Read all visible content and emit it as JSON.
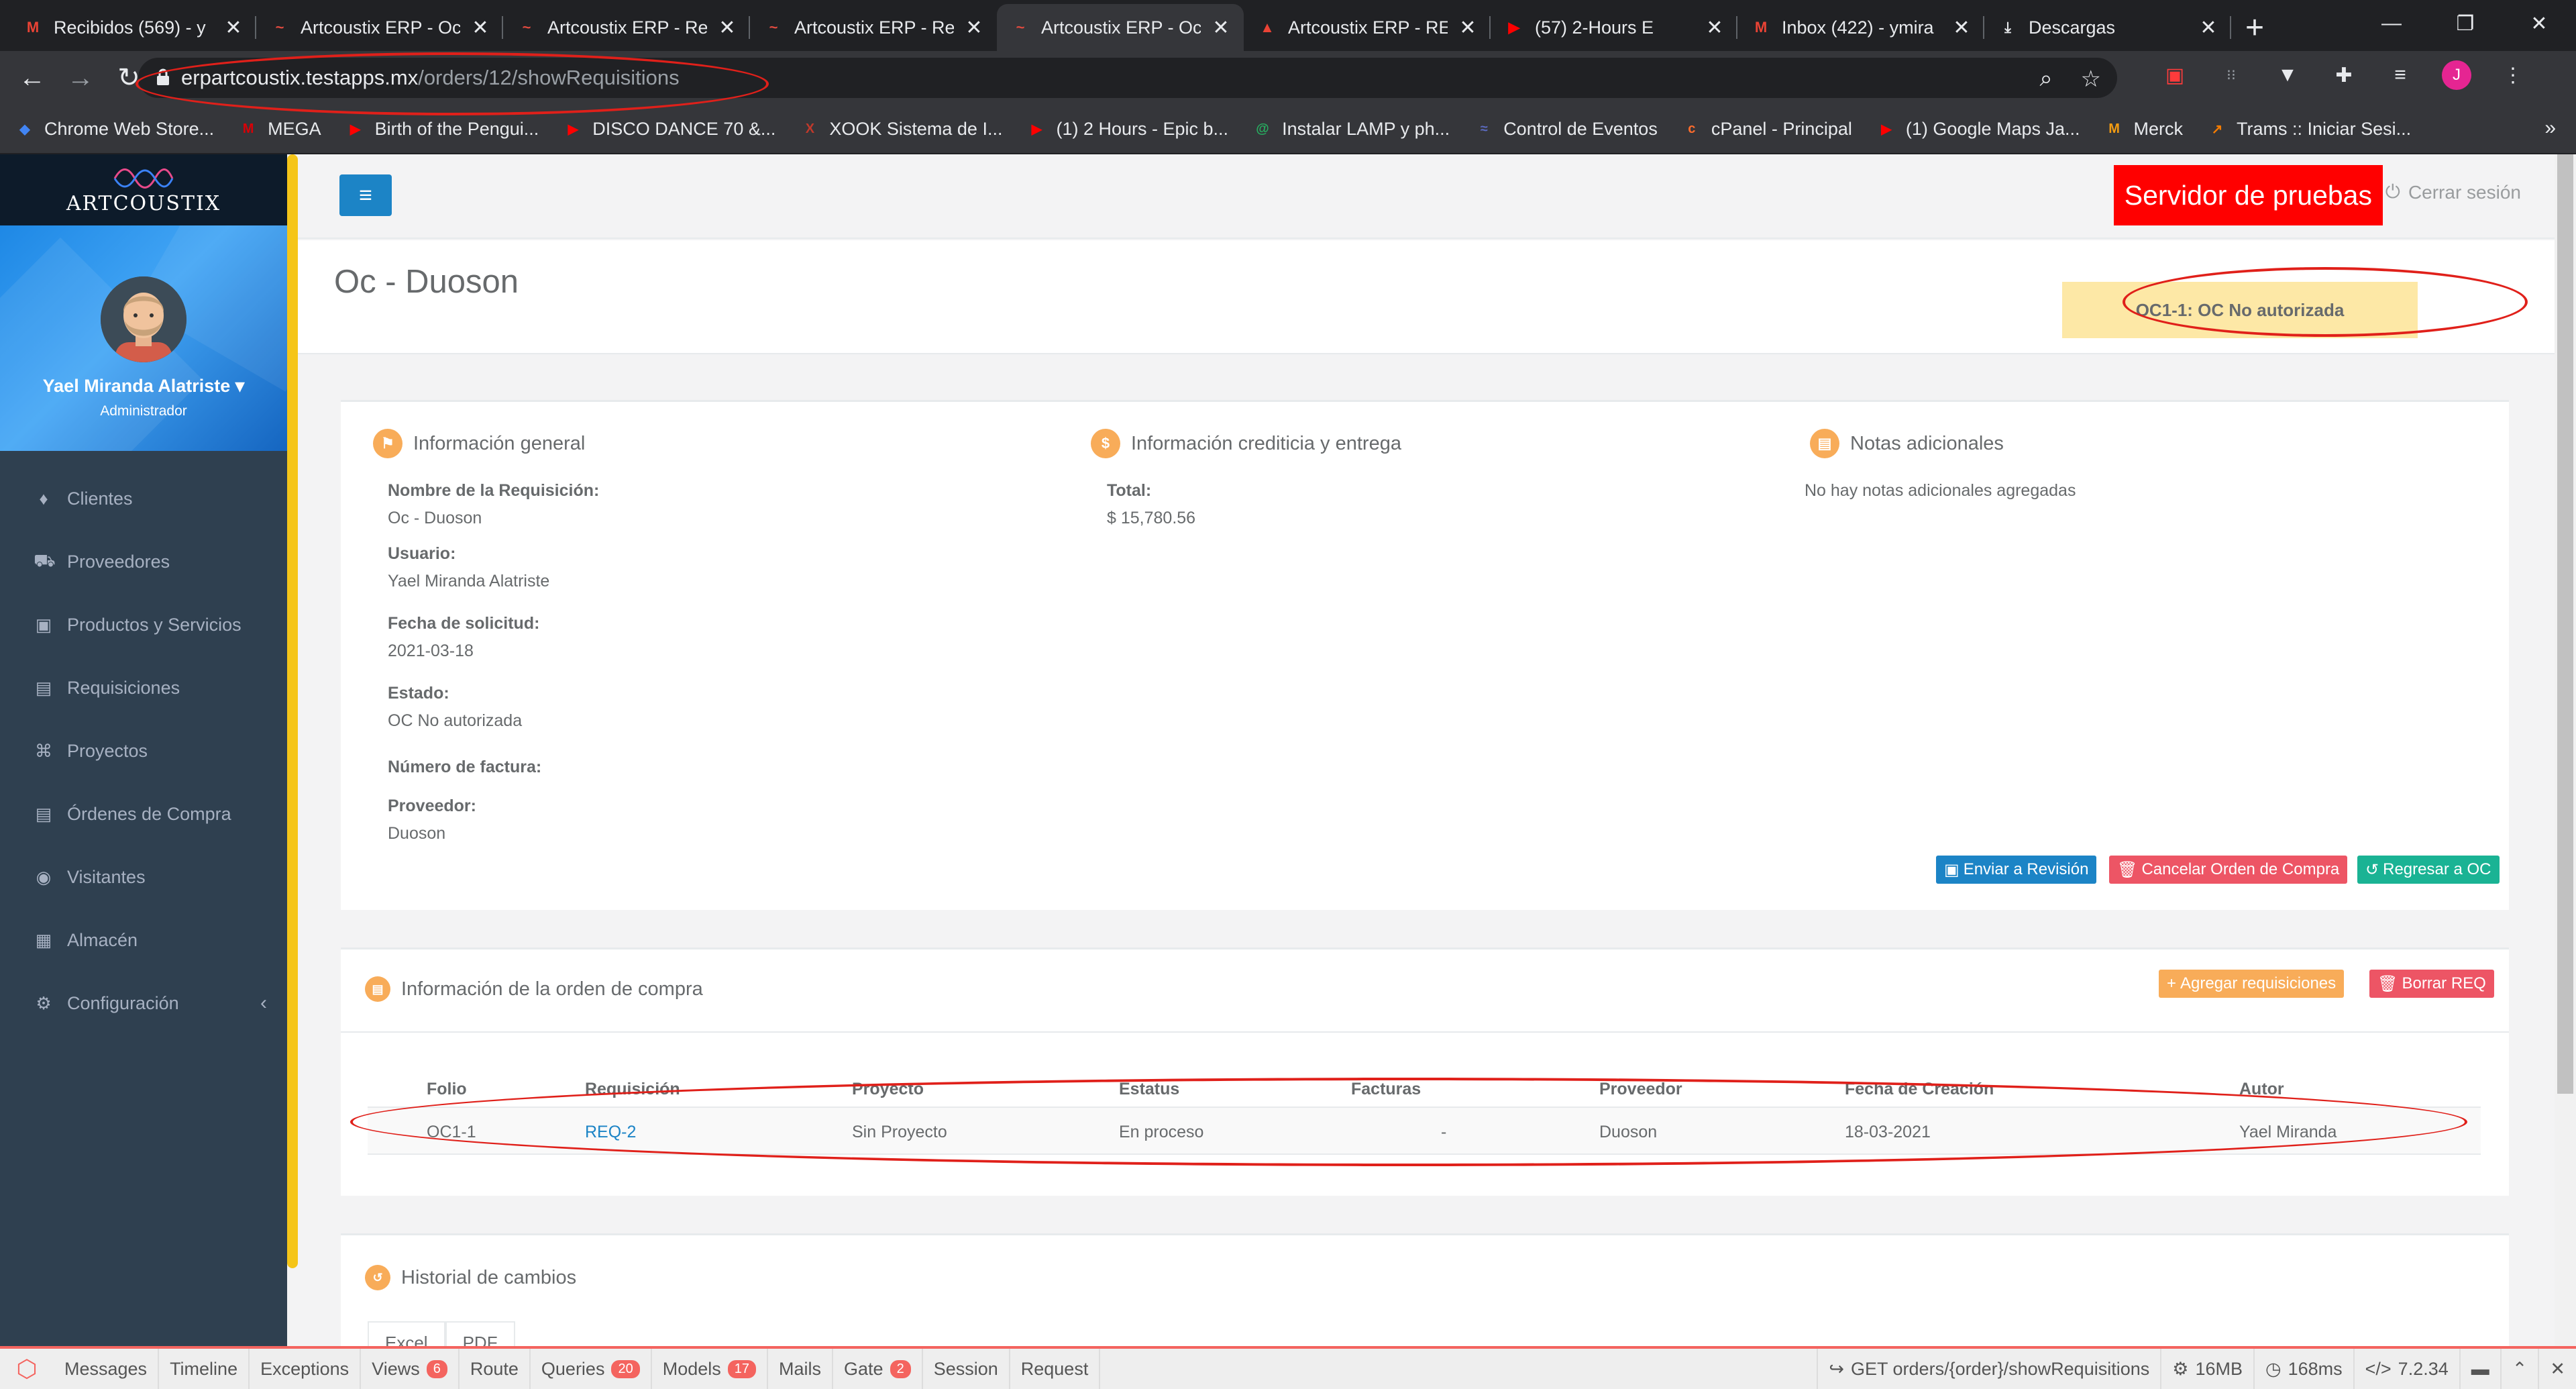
{
  "browser": {
    "tabs": [
      {
        "title": "Recibidos (569) - y",
        "favicon": "M",
        "color": "#ea4335"
      },
      {
        "title": "Artcoustix ERP - Oc",
        "favicon": "~",
        "color": "#e04a3f"
      },
      {
        "title": "Artcoustix ERP - Re",
        "favicon": "~",
        "color": "#e04a3f"
      },
      {
        "title": "Artcoustix ERP - Re",
        "favicon": "~",
        "color": "#e04a3f"
      },
      {
        "title": "Artcoustix ERP - Oc",
        "favicon": "~",
        "color": "#e04a3f"
      },
      {
        "title": "Artcoustix ERP - RE",
        "favicon": "▲",
        "color": "#ea4335"
      },
      {
        "title": "(57) 2-Hours E",
        "favicon": "▶",
        "color": "#ff0000"
      },
      {
        "title": "Inbox (422) - ymira",
        "favicon": "M",
        "color": "#ea4335"
      },
      {
        "title": "Descargas",
        "favicon": "⤓",
        "color": "#e8eaed"
      }
    ],
    "url_host": "erpartcoustix.testapps.mx",
    "url_path": "/orders/12/showRequisitions",
    "profile_letter": "J",
    "bookmarks": [
      {
        "label": "Chrome Web Store...",
        "color": "#4285f4",
        "glyph": "◆"
      },
      {
        "label": "MEGA",
        "color": "#d90007",
        "glyph": "M"
      },
      {
        "label": "Birth of the Pengui...",
        "color": "#ff0000",
        "glyph": "▶"
      },
      {
        "label": "DISCO DANCE 70 &...",
        "color": "#ff0000",
        "glyph": "▶"
      },
      {
        "label": "XOOK Sistema de I...",
        "color": "#c0392b",
        "glyph": "X"
      },
      {
        "label": "(1) 2 Hours - Epic b...",
        "color": "#ff0000",
        "glyph": "▶"
      },
      {
        "label": "Instalar LAMP y ph...",
        "color": "#27ae60",
        "glyph": "@"
      },
      {
        "label": "Control de Eventos",
        "color": "#5c6bc0",
        "glyph": "≈"
      },
      {
        "label": "cPanel - Principal",
        "color": "#ff6c2c",
        "glyph": "c"
      },
      {
        "label": "(1) Google Maps Ja...",
        "color": "#ff0000",
        "glyph": "▶"
      },
      {
        "label": "Merck",
        "color": "#f39c12",
        "glyph": "M"
      },
      {
        "label": "Trams :: Iniciar Sesi...",
        "color": "#f57c00",
        "glyph": "↗"
      }
    ]
  },
  "app": {
    "brand": "ARTCOUSTIX",
    "user_name": "Yael Miranda Alatriste",
    "user_role": "Administrador",
    "menu": [
      {
        "label": "Clientes",
        "icon": "diamond-icon",
        "glyph": "♦"
      },
      {
        "label": "Proveedores",
        "icon": "truck-icon",
        "glyph": "⛟"
      },
      {
        "label": "Productos y Servicios",
        "icon": "briefcase-icon",
        "glyph": "▣"
      },
      {
        "label": "Requisiciones",
        "icon": "file-icon",
        "glyph": "▤"
      },
      {
        "label": "Proyectos",
        "icon": "sitemap-icon",
        "glyph": "⌘"
      },
      {
        "label": "Órdenes de Compra",
        "icon": "file-icon",
        "glyph": "▤"
      },
      {
        "label": "Visitantes",
        "icon": "user-circle-icon",
        "glyph": "◉"
      },
      {
        "label": "Almacén",
        "icon": "cubes-icon",
        "glyph": "▦"
      },
      {
        "label": "Configuración",
        "icon": "cogs-icon",
        "glyph": "⚙"
      }
    ],
    "server_label": "Servidor de pruebas",
    "logout_label": "Cerrar sesión",
    "page_title": "Oc - Duoson",
    "status_label": "OC1-1: OC No autorizada"
  },
  "general": {
    "title": "Información general",
    "fields": [
      {
        "label": "Nombre de la Requisición:",
        "value": "Oc - Duoson"
      },
      {
        "label": "Usuario:",
        "value": "Yael Miranda Alatriste"
      },
      {
        "label": "Fecha de solicitud:",
        "value": "2021-03-18"
      },
      {
        "label": "Estado:",
        "value": "OC No autorizada"
      },
      {
        "label": "Número de factura:",
        "value": ""
      },
      {
        "label": "Proveedor:",
        "value": "Duoson"
      }
    ]
  },
  "credit": {
    "title": "Información crediticia y entrega",
    "total_label": "Total:",
    "total_value": "$ 15,780.56"
  },
  "notes": {
    "title": "Notas adicionales",
    "text": "No hay notas adicionales agregadas"
  },
  "actions": {
    "send_review": "Enviar a Revisión",
    "cancel_order": "Cancelar Orden de Compra",
    "back_oc": "Regresar a OC"
  },
  "order": {
    "title": "Información de la orden de compra",
    "add_req": "Agregar requisiciones",
    "delete_req": "Borrar REQ",
    "columns": [
      "Folio",
      "Requisición",
      "Proyecto",
      "Estatus",
      "Facturas",
      "Proveedor",
      "Fecha de Creación",
      "Autor"
    ],
    "rows": [
      [
        "OC1-1",
        "REQ-2",
        "Sin Proyecto",
        "En proceso",
        "-",
        "Duoson",
        "18-03-2021",
        "Yael Miranda"
      ]
    ]
  },
  "history": {
    "title": "Historial de cambios",
    "tabs": [
      "Excel",
      "PDF"
    ]
  },
  "debugbar": {
    "items": [
      {
        "label": "Messages",
        "badge": ""
      },
      {
        "label": "Timeline",
        "badge": ""
      },
      {
        "label": "Exceptions",
        "badge": ""
      },
      {
        "label": "Views",
        "badge": "6"
      },
      {
        "label": "Route",
        "badge": ""
      },
      {
        "label": "Queries",
        "badge": "20"
      },
      {
        "label": "Models",
        "badge": "17"
      },
      {
        "label": "Mails",
        "badge": ""
      },
      {
        "label": "Gate",
        "badge": "2"
      },
      {
        "label": "Session",
        "badge": ""
      },
      {
        "label": "Request",
        "badge": ""
      }
    ],
    "route": "GET orders/{order}/showRequisitions",
    "memory": "16MB",
    "time": "168ms",
    "php": "7.2.34"
  }
}
